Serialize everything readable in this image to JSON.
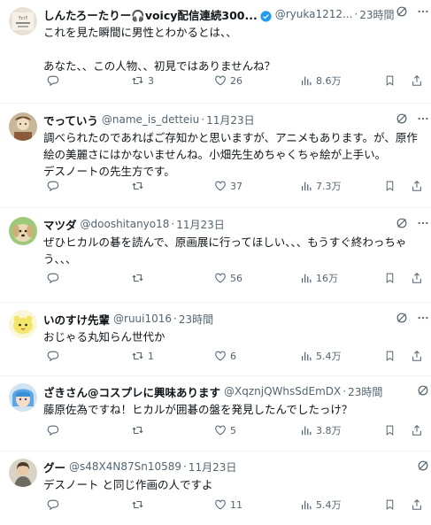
{
  "tweets": [
    {
      "name": "しんたろーたりー🎧voicy配信連続300...",
      "handle": "@ryuka1212...",
      "time": "23時間",
      "verified": true,
      "text": "これを見た瞬間に男性とわかるとは、、\n\nあなた、、この人物、、初見ではありませんね？",
      "reply": "",
      "retweet": "3",
      "like": "26",
      "views": "8.6万"
    },
    {
      "name": "でっていう",
      "handle": "@name_is_detteiu",
      "time": "11月23日",
      "verified": false,
      "text": "調べられたのであればご存知かと思いますが、アニメもあります。が、原作絵の美麗さにはかないませんね。小畑先生めちゃくちゃ絵が上手い。\nデスノートの先生方です。",
      "reply": "",
      "retweet": "",
      "like": "37",
      "views": "7.3万"
    },
    {
      "name": "マツダ",
      "handle": "@dooshitanyo18",
      "time": "11月23日",
      "verified": false,
      "text": "ぜひヒカルの碁を読んで、原画展に行ってほしい、、、もうすぐ終わっちゃう、、、",
      "reply": "",
      "retweet": "",
      "like": "56",
      "views": "16万"
    },
    {
      "name": "いのすけ先輩",
      "handle": "@ruui1016",
      "time": "23時間",
      "verified": false,
      "text": "おじゃる丸知らん世代か",
      "reply": "",
      "retweet": "1",
      "like": "6",
      "views": "5.4万"
    },
    {
      "name": "ざきさん@コスプレに興味あります",
      "handle": "@XqznjQWhsSdEmDX",
      "time": "23時間",
      "verified": false,
      "text": "藤原佐為ですね！ヒカルが囲碁の盤を発見したんでしたっけ？",
      "reply": "",
      "retweet": "",
      "like": "5",
      "views": "3.8万"
    },
    {
      "name": "グー",
      "handle": "@s48X4N87Sn10589",
      "time": "11月23日",
      "verified": false,
      "text": "デスノート と同じ作画の人ですよ",
      "reply": "",
      "retweet": "",
      "like": "11",
      "views": "5.4万"
    }
  ],
  "colors": {
    "text": "#0f1419",
    "secondary": "#536471",
    "verified": "#1d9bf0",
    "divider": "#eff3f4"
  },
  "icons": {
    "reply": "reply-icon",
    "retweet": "retweet-icon",
    "like": "like-icon",
    "views": "views-icon",
    "bookmark": "bookmark-icon",
    "share": "share-icon",
    "grok": "grok-icon",
    "more": "more-icon",
    "verified": "verified-badge-icon"
  }
}
